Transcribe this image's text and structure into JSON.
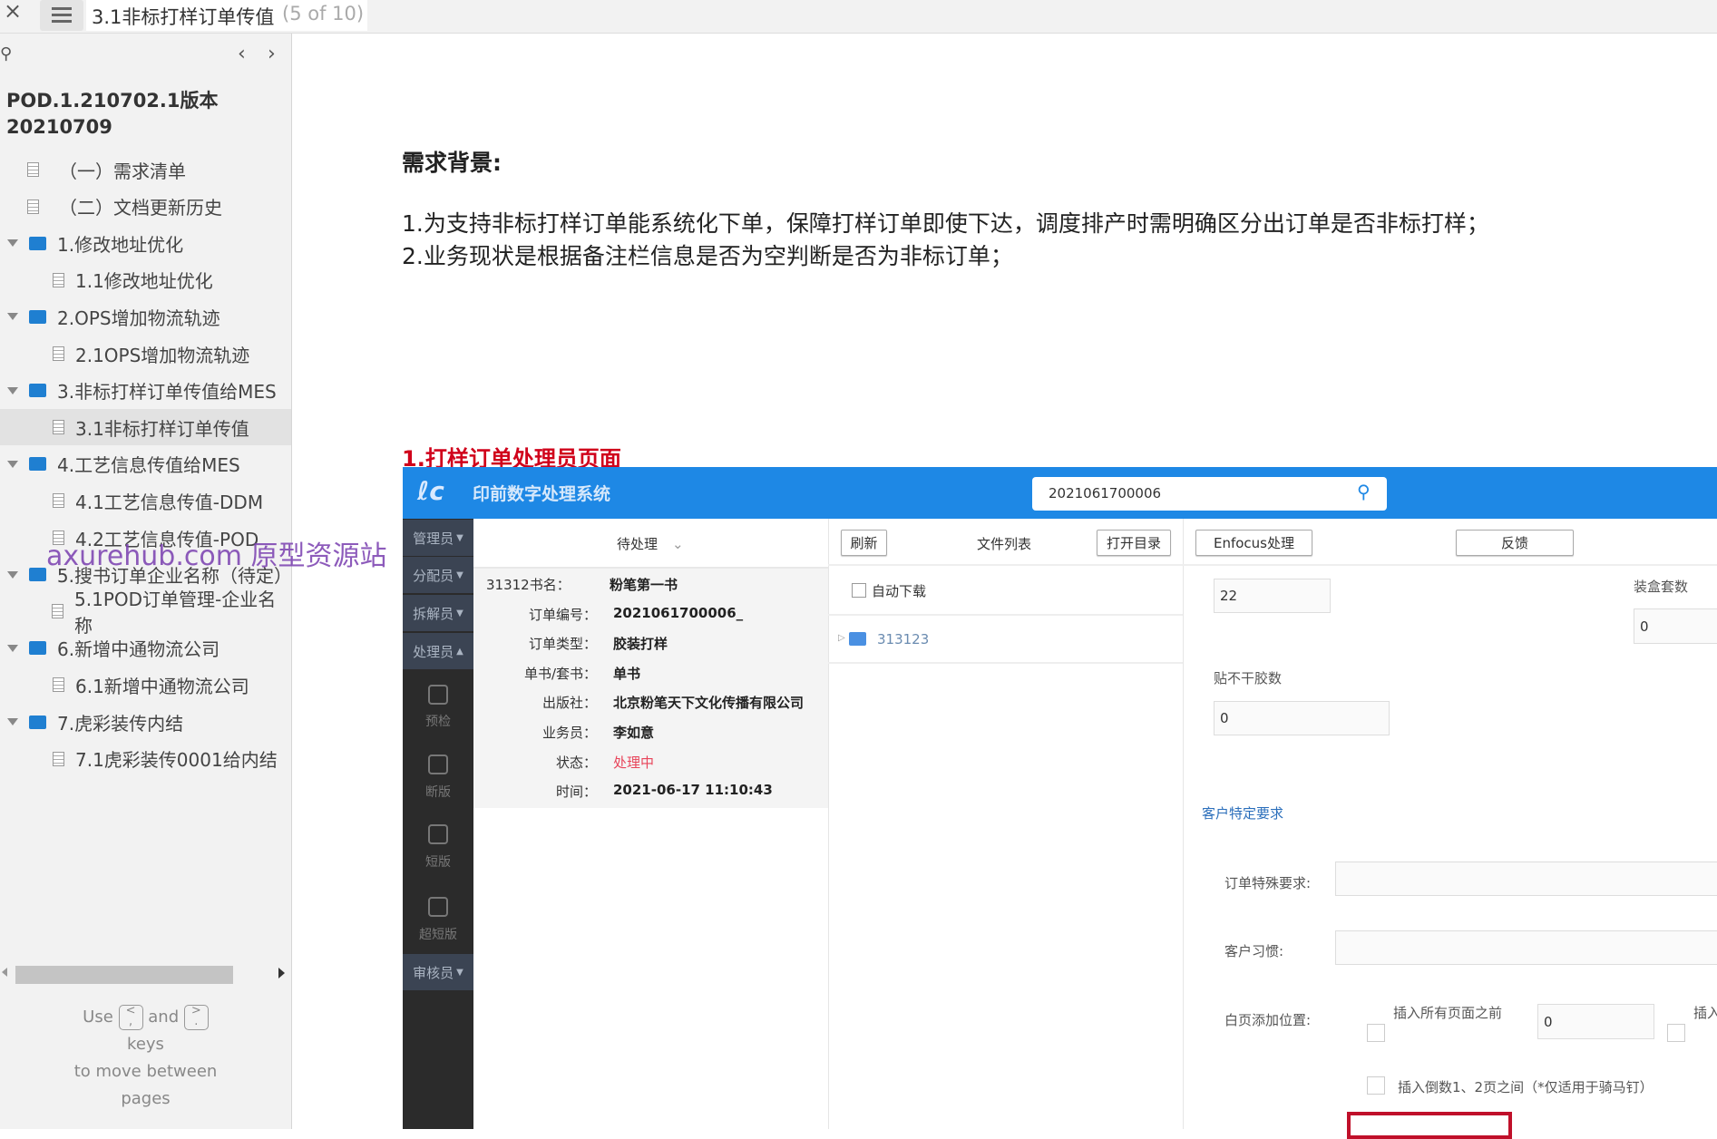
{
  "topbar": {
    "close": "×",
    "title": "3.1非标打样订单传值",
    "page_count": "(5 of 10)"
  },
  "sidebar": {
    "project_title_line1": "POD.1.210702.1版本",
    "project_title_line2": "20210709",
    "items": [
      {
        "label": "（一）需求清单",
        "type": "page",
        "level": 0
      },
      {
        "label": "（二）文档更新历史",
        "type": "page",
        "level": 0
      },
      {
        "label": "1.修改地址优化",
        "type": "folder",
        "level": 0
      },
      {
        "label": "1.1修改地址优化",
        "type": "page",
        "level": 1
      },
      {
        "label": "2.OPS增加物流轨迹",
        "type": "folder",
        "level": 0
      },
      {
        "label": "2.1OPS增加物流轨迹",
        "type": "page",
        "level": 1
      },
      {
        "label": "3.非标打样订单传值给MES",
        "type": "folder",
        "level": 0
      },
      {
        "label": "3.1非标打样订单传值",
        "type": "page",
        "level": 1,
        "selected": true
      },
      {
        "label": "4.工艺信息传值给MES",
        "type": "folder",
        "level": 0
      },
      {
        "label": "4.1工艺信息传值-DDM",
        "type": "page",
        "level": 1
      },
      {
        "label": "4.2工艺信息传值-POD",
        "type": "page",
        "level": 1
      },
      {
        "label": "5.搜书订单企业名称（待定）",
        "type": "folder",
        "level": 0
      },
      {
        "label": "5.1POD订单管理-企业名称",
        "type": "page",
        "level": 1
      },
      {
        "label": "6.新增中通物流公司",
        "type": "folder",
        "level": 0
      },
      {
        "label": "6.1新增中通物流公司",
        "type": "page",
        "level": 1
      },
      {
        "label": "7.虎彩装传内结",
        "type": "folder",
        "level": 0
      },
      {
        "label": "7.1虎彩装传0001给内结",
        "type": "page",
        "level": 1
      }
    ],
    "hint": {
      "use": "Use",
      "key1": "<",
      "key1b": ",",
      "and": "and",
      "key2": ">",
      "key2b": ".",
      "keys": "keys",
      "line3": "to move between",
      "line4": "pages"
    }
  },
  "watermark": "axurehub.com 原型资源站",
  "content": {
    "bg_heading": "需求背景:",
    "bg_lines": [
      "1.为支持非标打样订单能系统化下单，保障打样订单即使下达，调度排产时需明确区分出订单是否非标打样；",
      "2.业务现状是根据备注栏信息是否为空判断是否为非标订单；"
    ],
    "section_heading": "1.打样订单处理员页面"
  },
  "app": {
    "title": "印前数字处理系统",
    "search_value": "2021061700006",
    "colors": {
      "header": "#1e88e5",
      "sidebar": "#2b2b2b",
      "status": "#e8445a",
      "section": "#2a6ebb",
      "highlight": "#c0102a"
    },
    "menu": [
      "管理员",
      "分配员",
      "拆解员",
      "处理员",
      "审核员"
    ],
    "sub_items": [
      "预检",
      "断版",
      "短版",
      "超短版"
    ],
    "filter": "待处理",
    "info": [
      {
        "label": "31312书名：",
        "value": "粉笔第一书"
      },
      {
        "label": "订单编号：",
        "value": "2021061700006_"
      },
      {
        "label": "订单类型：",
        "value": "胶装打样"
      },
      {
        "label": "单书/套书：",
        "value": "单书"
      },
      {
        "label": "出版社：",
        "value": "北京粉笔天下文化传播有限公司"
      },
      {
        "label": "业务员：",
        "value": "李如意"
      },
      {
        "label": "状态：",
        "value": "处理中"
      },
      {
        "label": "时间：",
        "value": "2021-06-17 11:10:43"
      }
    ],
    "files": {
      "refresh": "刷新",
      "title": "文件列表",
      "open_dir": "打开目录",
      "auto_download": "自动下载",
      "folder": "313123"
    },
    "form": {
      "enfocus": "Enfocus处理",
      "feedback": "反馈",
      "field1_value": "22",
      "box_sets_label": "装盒套数",
      "box_sets_value": "0",
      "sticker_label": "贴不干胶数",
      "sticker_value": "0",
      "customer_section": "客户特定要求",
      "special_label": "订单特殊要求:",
      "special_value": "",
      "habit_label": "客户习惯:",
      "habit_value": "",
      "blank_label": "白页添加位置:",
      "opt_before_all": "插入所有页面之前",
      "opt_before_value": "0",
      "opt_cut": "插入",
      "opt_between": "插入倒数1、2页之间（*仅适用于骑马钉）"
    }
  }
}
